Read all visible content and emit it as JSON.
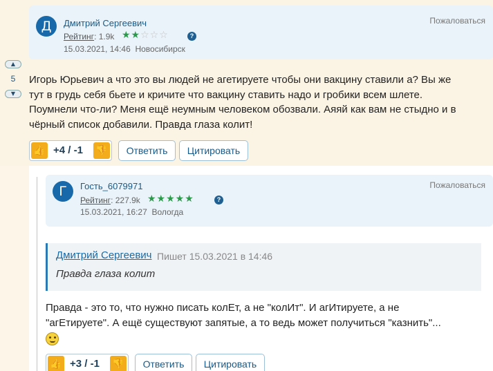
{
  "comment1": {
    "avatar_letter": "Д",
    "author": "Дмитрий Сергеевич",
    "rating_label": "Рейтинг",
    "rating_value": ": 1.9k",
    "stars_on": "★★",
    "stars_off": "☆☆☆",
    "help": "?",
    "date": "15.03.2021, 14:46",
    "city": "Новосибирск",
    "report": "Пожаловаться",
    "vote_up": "▲",
    "vote_down": "▼",
    "vote_count": "5",
    "lines": [
      "Игорь Юрьевич а что это вы людей не агетируете чтобы они вакцину ставили а? Вы же",
      "тут в грудь себя бьете и кричите что вакцину ставить надо и гробики всем шлете.",
      "Поумнели что-ли? Меня ещё неумным человеком обозвали. Аяяй как вам не стыдно и в",
      "чёрный список добавили. Правда глаза колит!"
    ],
    "score": "+4 / -1",
    "reply": "Ответить",
    "quote": "Цитировать"
  },
  "comment2": {
    "avatar_letter": "Г",
    "author": "Гость_6079971",
    "rating_label": "Рейтинг",
    "rating_value": ": 227.9k",
    "stars_on": "★★★★★",
    "help": "?",
    "date": "15.03.2021, 16:27",
    "city": "Вологда",
    "report": "Пожаловаться",
    "quoted_author": "Дмитрий Сергеевич",
    "quoted_meta": "Пишет 15.03.2021 в 14:46",
    "quoted_text": "Правда глаза колит",
    "lines": [
      "Правда - это то, что нужно писать колЕт, а не \"колИт\". И агИтируете, а не",
      "\"агЕтируете\". А ещё существуют запятые, а то ведь может получиться \"казнить\"..."
    ],
    "score": "+3 / -1",
    "reply": "Ответить",
    "quote": "Цитировать"
  },
  "icons": {
    "thumb_up": "👍",
    "thumb_down": "👎"
  },
  "colors": {
    "accent": "#1a5a86",
    "avatar": "#1769aa",
    "star": "#2a9a4a",
    "thumb": "#f2ac1c",
    "header_bg": "#e9f3f9"
  }
}
